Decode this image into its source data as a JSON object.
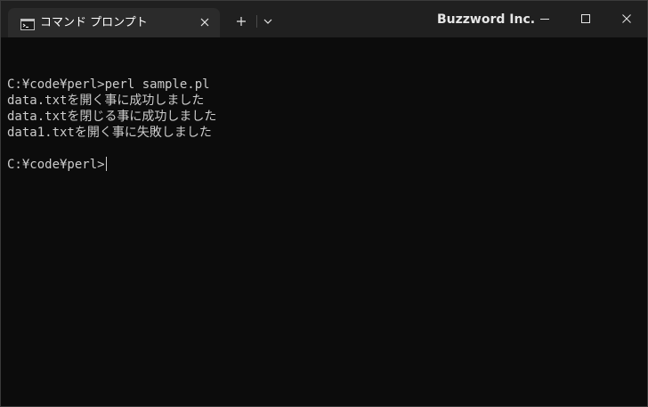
{
  "tab": {
    "title": "コマンド プロンプト",
    "icon": "command-prompt-icon"
  },
  "titlebar": {
    "brand": "Buzzword Inc.",
    "new_tab_icon": "plus-icon",
    "dropdown_icon": "chevron-down-icon",
    "minimize_icon": "minimize-icon",
    "maximize_icon": "maximize-icon",
    "close_icon": "close-icon"
  },
  "terminal": {
    "lines": [
      "",
      "C:¥code¥perl>perl sample.pl",
      "data.txtを開く事に成功しました",
      "data.txtを閉じる事に成功しました",
      "data1.txtを開く事に失敗しました",
      "",
      "C:¥code¥perl>"
    ]
  },
  "colors": {
    "terminal_background": "#0c0c0c",
    "titlebar_background": "#202020",
    "tab_background": "#2b2b2b",
    "text": "#cccccc"
  }
}
